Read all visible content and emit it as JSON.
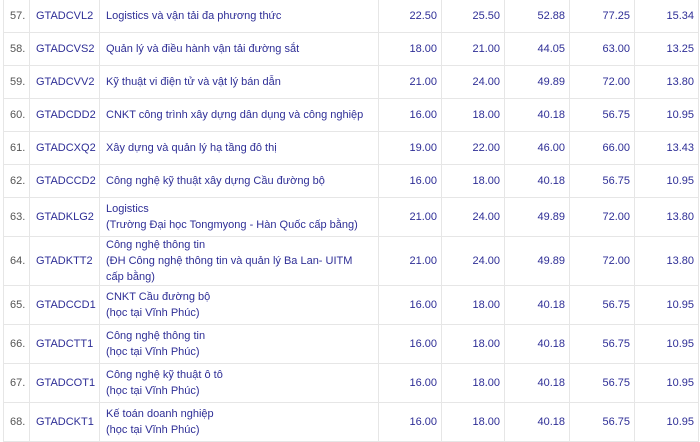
{
  "rows": [
    {
      "stt": "57.",
      "code": "GTADCVL2",
      "name": "Logistics và vận tải đa phương thức",
      "sub": "",
      "v": [
        "22.50",
        "25.50",
        "52.88",
        "77.25",
        "15.34"
      ]
    },
    {
      "stt": "58.",
      "code": "GTADCVS2",
      "name": "Quản lý và điều hành vận tải đường sắt",
      "sub": "",
      "v": [
        "18.00",
        "21.00",
        "44.05",
        "63.00",
        "13.25"
      ]
    },
    {
      "stt": "59.",
      "code": "GTADCVV2",
      "name": "Kỹ thuật vi điện tử và vật lý bán dẫn",
      "sub": "",
      "v": [
        "21.00",
        "24.00",
        "49.89",
        "72.00",
        "13.80"
      ]
    },
    {
      "stt": "60.",
      "code": "GTADCDD2",
      "name": "CNKT công trình xây dựng dân dụng và công nghiệp",
      "sub": "",
      "v": [
        "16.00",
        "18.00",
        "40.18",
        "56.75",
        "10.95"
      ]
    },
    {
      "stt": "61.",
      "code": "GTADCXQ2",
      "name": "Xây dựng và quản lý hạ tầng đô thị",
      "sub": "",
      "v": [
        "19.00",
        "22.00",
        "46.00",
        "66.00",
        "13.43"
      ]
    },
    {
      "stt": "62.",
      "code": "GTADCCD2",
      "name": "Công nghệ kỹ thuật xây dựng Cầu đường bộ",
      "sub": "",
      "v": [
        "16.00",
        "18.00",
        "40.18",
        "56.75",
        "10.95"
      ]
    },
    {
      "stt": "63.",
      "code": "GTADKLG2",
      "name": "Logistics",
      "sub": "(Trường Đại học Tongmyong - Hàn Quốc cấp bằng)",
      "v": [
        "21.00",
        "24.00",
        "49.89",
        "72.00",
        "13.80"
      ]
    },
    {
      "stt": "64.",
      "code": "GTADKTT2",
      "name": "Công nghệ thông tin",
      "sub": "(ĐH Công nghệ thông tin và quản lý Ba Lan- UITM cấp bằng)",
      "v": [
        "21.00",
        "24.00",
        "49.89",
        "72.00",
        "13.80"
      ]
    },
    {
      "stt": "65.",
      "code": "GTADCCD1",
      "name": "CNKT Cầu đường bộ",
      "sub": "(học tại Vĩnh Phúc)",
      "v": [
        "16.00",
        "18.00",
        "40.18",
        "56.75",
        "10.95"
      ]
    },
    {
      "stt": "66.",
      "code": "GTADCTT1",
      "name": "Công nghệ thông tin",
      "sub": "(học tại Vĩnh Phúc)",
      "v": [
        "16.00",
        "18.00",
        "40.18",
        "56.75",
        "10.95"
      ]
    },
    {
      "stt": "67.",
      "code": "GTADCOT1",
      "name": "Công nghệ kỹ thuật ô tô",
      "sub": "(học tại Vĩnh Phúc)",
      "v": [
        "16.00",
        "18.00",
        "40.18",
        "56.75",
        "10.95"
      ]
    },
    {
      "stt": "68.",
      "code": "GTADCKT1",
      "name": "Kế toán doanh nghiệp",
      "sub": "(học tại Vĩnh Phúc)",
      "v": [
        "16.00",
        "18.00",
        "40.18",
        "56.75",
        "10.95"
      ]
    }
  ]
}
